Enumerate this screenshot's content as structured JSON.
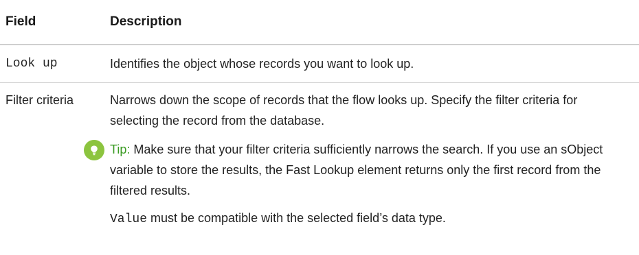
{
  "header": {
    "field": "Field",
    "description": "Description"
  },
  "rows": [
    {
      "field": "Look up",
      "description": "Identifies the object whose records you want to look up."
    },
    {
      "field": "Filter criteria",
      "description": "Narrows down the scope of records that the flow looks up. Specify the filter criteria for selecting the record from the database.",
      "tip": {
        "icon": "lightbulb-icon",
        "label": "Tip:",
        "text": " Make sure that your filter criteria sufficiently narrows the search. If you use an sObject variable to store the results, the Fast Lookup element returns only the first record from the filtered results."
      },
      "note": {
        "code": "Value",
        "text": " must be compatible with the selected field’s data type."
      }
    }
  ],
  "colors": {
    "tip_icon": "#8cc43f",
    "tip_label": "#3a9b23"
  }
}
